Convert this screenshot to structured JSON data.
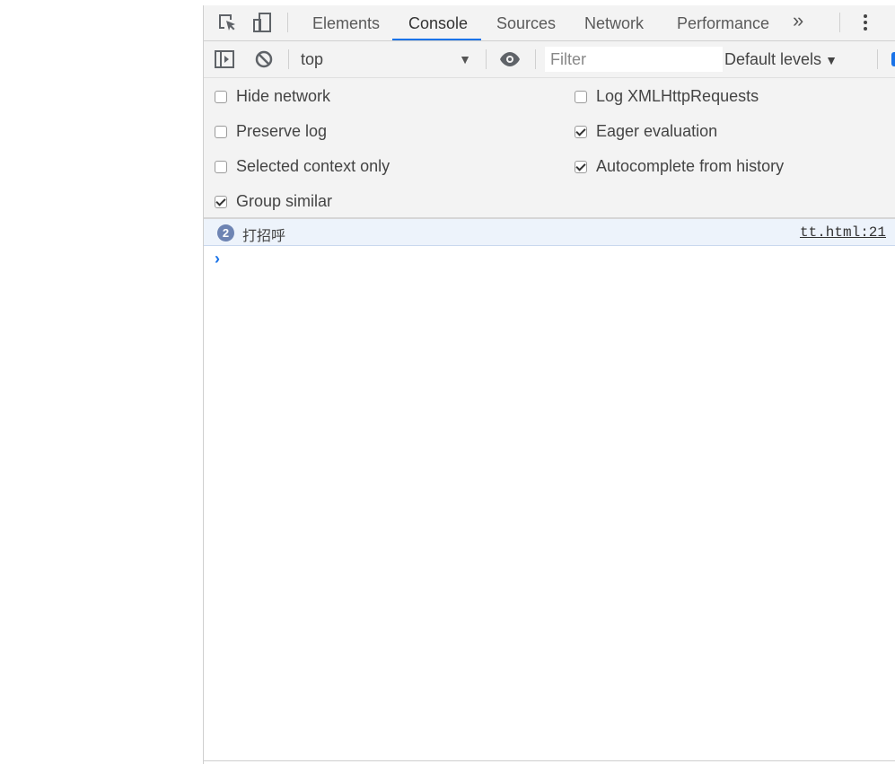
{
  "tabs": [
    {
      "label": "Elements"
    },
    {
      "label": "Console"
    },
    {
      "label": "Sources"
    },
    {
      "label": "Network"
    },
    {
      "label": "Performance"
    }
  ],
  "more_tabs": "»",
  "toolbar": {
    "context": "top",
    "filter_placeholder": "Filter",
    "levels": "Default levels"
  },
  "settings": {
    "left": [
      {
        "label": "Hide network",
        "checked": false
      },
      {
        "label": "Preserve log",
        "checked": false
      },
      {
        "label": "Selected context only",
        "checked": false
      },
      {
        "label": "Group similar",
        "checked": true
      }
    ],
    "right": [
      {
        "label": "Log XMLHttpRequests",
        "checked": false
      },
      {
        "label": "Eager evaluation",
        "checked": true
      },
      {
        "label": "Autocomplete from history",
        "checked": true
      }
    ]
  },
  "log": {
    "count": "2",
    "message": "打招呼",
    "source": "tt.html:21"
  },
  "prompt_symbol": "›",
  "colors": {
    "accent": "#1a73e8",
    "panel_bg": "#f3f3f3",
    "log_bg": "#edf3fb"
  }
}
